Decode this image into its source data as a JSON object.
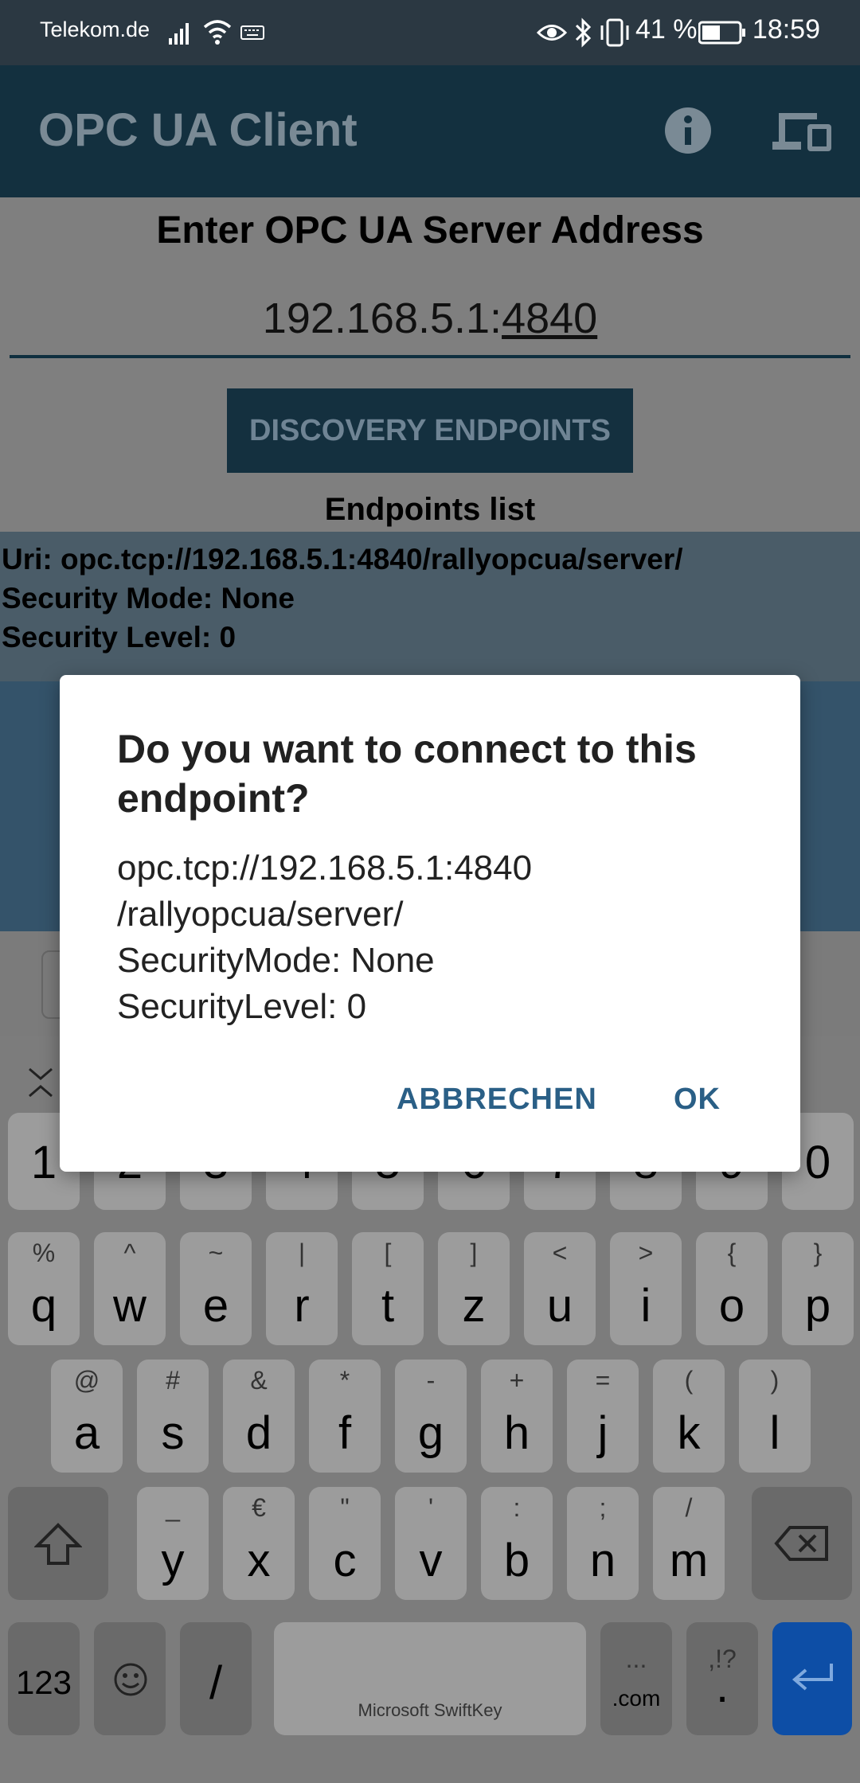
{
  "status_bar": {
    "carrier": "Telekom.de",
    "battery_percent": "41 %",
    "time": "18:59",
    "icons": [
      "signal-icon",
      "wifi-icon",
      "keyboard-icon",
      "eye-icon",
      "bluetooth-icon",
      "vibrate-icon",
      "battery-icon"
    ]
  },
  "app_bar": {
    "title": "OPC UA Client",
    "icons": [
      "info-icon",
      "devices-icon"
    ]
  },
  "main": {
    "heading": "Enter OPC UA Server Address",
    "address_prefix": "192.168.5.1:",
    "address_port": "4840",
    "discover_button": "DISCOVERY ENDPOINTS",
    "endpoints_title": "Endpoints list",
    "endpoint": {
      "uri": "Uri: opc.tcp://192.168.5.1:4840/rallyopcua/server/",
      "security_mode": "Security Mode: None",
      "security_level": "Security Level: 0"
    }
  },
  "dialog": {
    "title": "Do you want to connect to this endpoint?",
    "line1": "opc.tcp://192.168.5.1:4840",
    "line2": "/rallyopcua/server/",
    "line3": "SecurityMode: None",
    "line4": "SecurityLevel: 0",
    "cancel": "ABBRECHEN",
    "ok": "OK"
  },
  "keyboard": {
    "numbers": [
      "1",
      "2",
      "3",
      "4",
      "5",
      "6",
      "7",
      "8",
      "9",
      "0"
    ],
    "row1": [
      {
        "main": "q",
        "sub": "%"
      },
      {
        "main": "w",
        "sub": "^"
      },
      {
        "main": "e",
        "sub": "~"
      },
      {
        "main": "r",
        "sub": "|"
      },
      {
        "main": "t",
        "sub": "["
      },
      {
        "main": "z",
        "sub": "]"
      },
      {
        "main": "u",
        "sub": "<"
      },
      {
        "main": "i",
        "sub": ">"
      },
      {
        "main": "o",
        "sub": "{"
      },
      {
        "main": "p",
        "sub": "}"
      }
    ],
    "row2": [
      {
        "main": "a",
        "sub": "@"
      },
      {
        "main": "s",
        "sub": "#"
      },
      {
        "main": "d",
        "sub": "&"
      },
      {
        "main": "f",
        "sub": "*"
      },
      {
        "main": "g",
        "sub": "-"
      },
      {
        "main": "h",
        "sub": "+"
      },
      {
        "main": "j",
        "sub": "="
      },
      {
        "main": "k",
        "sub": "("
      },
      {
        "main": "l",
        "sub": ")"
      }
    ],
    "row3": [
      {
        "main": "y",
        "sub": "_"
      },
      {
        "main": "x",
        "sub": "€"
      },
      {
        "main": "c",
        "sub": "\""
      },
      {
        "main": "v",
        "sub": "'"
      },
      {
        "main": "b",
        "sub": ":"
      },
      {
        "main": "n",
        "sub": ";"
      },
      {
        "main": "m",
        "sub": "/"
      }
    ],
    "bottom": {
      "numbers_key": "123",
      "slash": "/",
      "space_label": "Microsoft SwiftKey",
      "dotcom_sub": "...",
      "dotcom": ".com",
      "period_sub": ",!?",
      "period": "."
    }
  }
}
